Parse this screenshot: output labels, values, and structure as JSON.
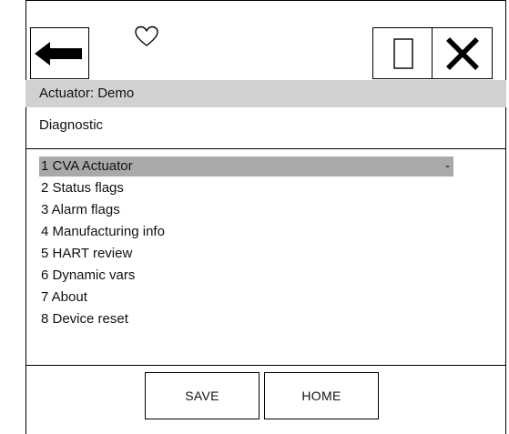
{
  "toolbar": {
    "back_icon": "left-arrow-icon",
    "favorite_icon": "heart-outline-icon",
    "window_icon": "window-icon",
    "close_icon": "close-x-icon"
  },
  "header": {
    "title": "Actuator: Demo",
    "subtitle": "Diagnostic"
  },
  "menu": {
    "items": [
      {
        "label": "1 CVA Actuator",
        "marker": "-"
      },
      {
        "label": "2 Status flags"
      },
      {
        "label": "3 Alarm flags"
      },
      {
        "label": "4 Manufacturing info"
      },
      {
        "label": "5 HART review"
      },
      {
        "label": "6 Dynamic vars"
      },
      {
        "label": "7 About"
      },
      {
        "label": "8 Device reset"
      }
    ]
  },
  "footer": {
    "save_label": "SAVE",
    "home_label": "HOME"
  }
}
